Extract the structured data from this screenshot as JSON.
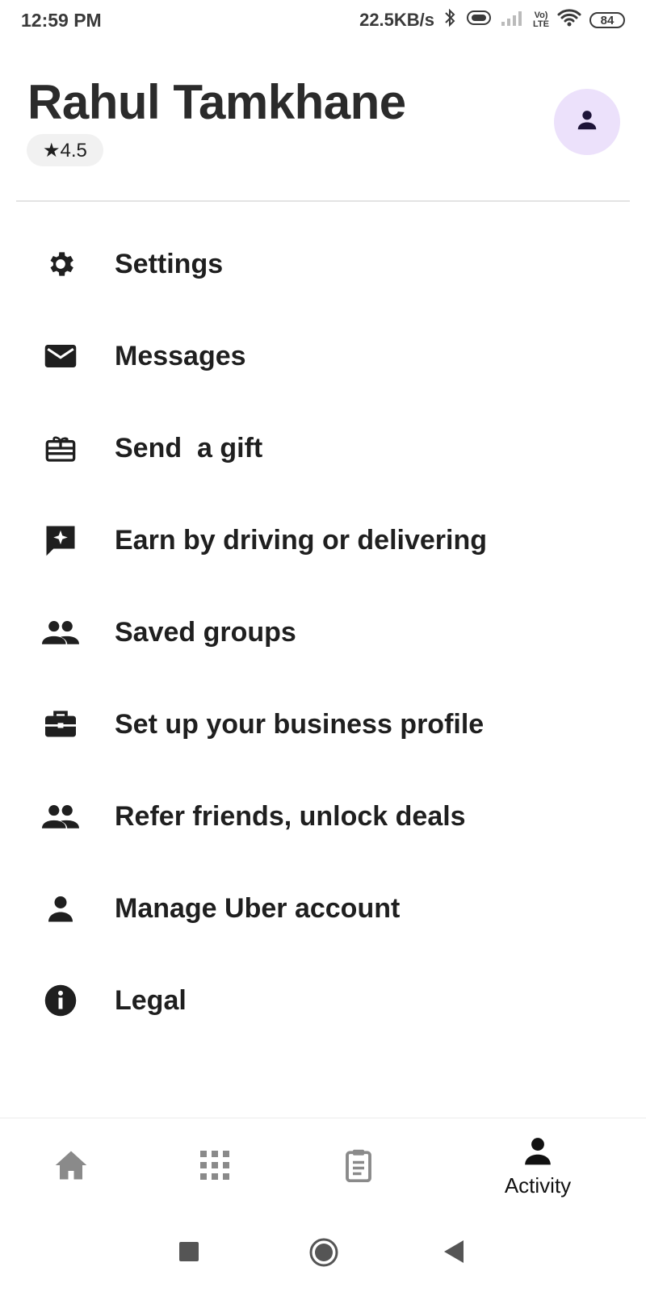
{
  "status_bar": {
    "time": "12:59 PM",
    "net_speed": "22.5KB/s",
    "volte_top": "Vo)",
    "volte_bottom": "LTE",
    "battery": "84"
  },
  "profile": {
    "name": "Rahul Tamkhane",
    "rating": "★4.5"
  },
  "menu": {
    "items": [
      {
        "label": "Settings",
        "icon": "gear-icon"
      },
      {
        "label": "Messages",
        "icon": "mail-icon"
      },
      {
        "label": "Send  a gift",
        "icon": "gift-card-icon"
      },
      {
        "label": "Earn by driving or delivering",
        "icon": "chat-sparkle-icon"
      },
      {
        "label": "Saved groups",
        "icon": "group-icon"
      },
      {
        "label": "Set up your business profile",
        "icon": "briefcase-icon"
      },
      {
        "label": "Refer friends, unlock deals",
        "icon": "group-icon"
      },
      {
        "label": "Manage Uber account",
        "icon": "person-icon"
      },
      {
        "label": "Legal",
        "icon": "info-icon"
      }
    ]
  },
  "bottom_nav": {
    "activity_label": "Activity"
  },
  "colors": {
    "avatar_bg": "#ece1fb",
    "inactive_nav": "#8a8a8a",
    "text": "#1f1f1f"
  }
}
